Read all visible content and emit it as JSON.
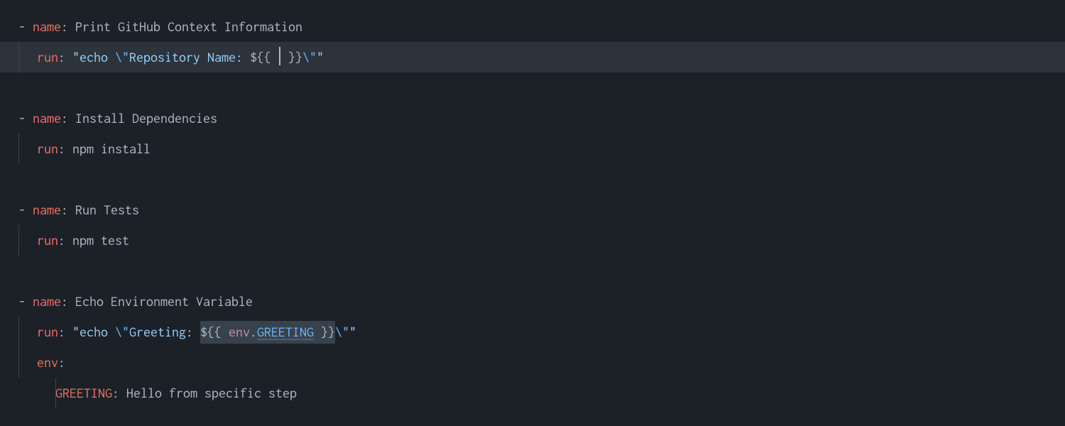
{
  "yaml": {
    "dash": "- ",
    "keys": {
      "name": "name",
      "run": "run",
      "env": "env",
      "greeting": "GREETING"
    },
    "colon": ":",
    "colon_space": ": "
  },
  "steps": [
    {
      "name": "Print GitHub Context Information",
      "run_prefix": "\"echo ",
      "run_esc1": "\\\"",
      "run_text": "Repository Name: ",
      "expr_open": "${{ ",
      "expr_close": " }}",
      "run_esc2": "\\\"",
      "run_suffix": "\""
    },
    {
      "name": "Install Dependencies",
      "run": "npm install"
    },
    {
      "name": "Run Tests",
      "run": "npm test"
    },
    {
      "name": "Echo Environment Variable",
      "run_prefix": "\"echo ",
      "run_esc1": "\\\"",
      "run_text": "Greeting: ",
      "expr_open": "${{ ",
      "expr_var": "env",
      "expr_dot": ".",
      "expr_prop": "GREETING",
      "expr_close": " }}",
      "run_esc2": "\\\"",
      "run_suffix": "\"",
      "env_key": "GREETING",
      "env_value": "Hello from specific step"
    }
  ]
}
